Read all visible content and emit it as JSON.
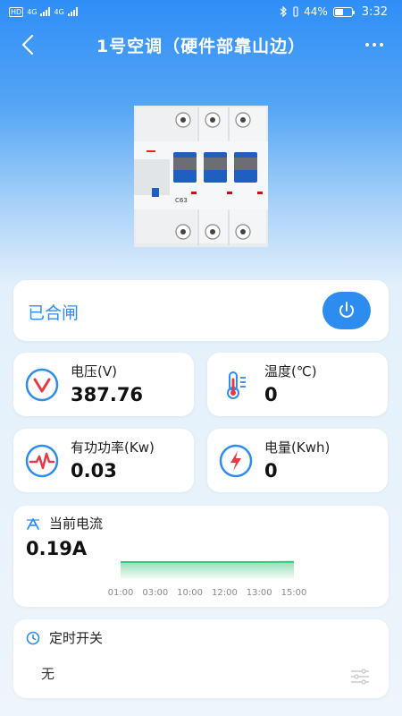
{
  "status_bar": {
    "network_label": "HD",
    "sim1": "4G",
    "sim2": "4G",
    "battery": "44%",
    "time": "3:32"
  },
  "header": {
    "title": "1号空调（硬件部靠山边）",
    "back_icon": "chevron-left-icon",
    "more_icon": "more-dots-icon"
  },
  "device": {
    "model": "C63",
    "image_icon": "circuit-breaker-image"
  },
  "switch": {
    "status_text": "已合闸",
    "power_icon": "power-icon",
    "accent": "#2c8cf0"
  },
  "metrics": {
    "voltage": {
      "label": "电压(V)",
      "value": "387.76",
      "icon": "voltage-icon",
      "color": "#e63946"
    },
    "temperature": {
      "label": "温度(℃)",
      "value": "0",
      "icon": "thermometer-icon",
      "color": "#2c8cf0"
    },
    "active_power": {
      "label": "有功功率(Kw)",
      "value": "0.03",
      "icon": "pulse-icon",
      "color": "#e63946"
    },
    "energy": {
      "label": "电量(Kwh)",
      "value": "0",
      "icon": "lightning-icon",
      "color": "#e63946"
    }
  },
  "current": {
    "title": "当前电流",
    "value": "0.19A",
    "icon": "current-icon"
  },
  "chart_data": {
    "type": "area",
    "x": [
      "01:00",
      "03:00",
      "10:00",
      "12:00",
      "13:00",
      "15:00"
    ],
    "values": [
      0.19,
      0.19,
      0.19,
      0.19,
      0.19,
      0.2
    ],
    "color": "#3cc57b",
    "title": "",
    "xlabel": "",
    "ylabel": ""
  },
  "timer": {
    "title": "定时开关",
    "value": "无",
    "clock_icon": "clock-icon",
    "settings_icon": "sliders-icon"
  }
}
